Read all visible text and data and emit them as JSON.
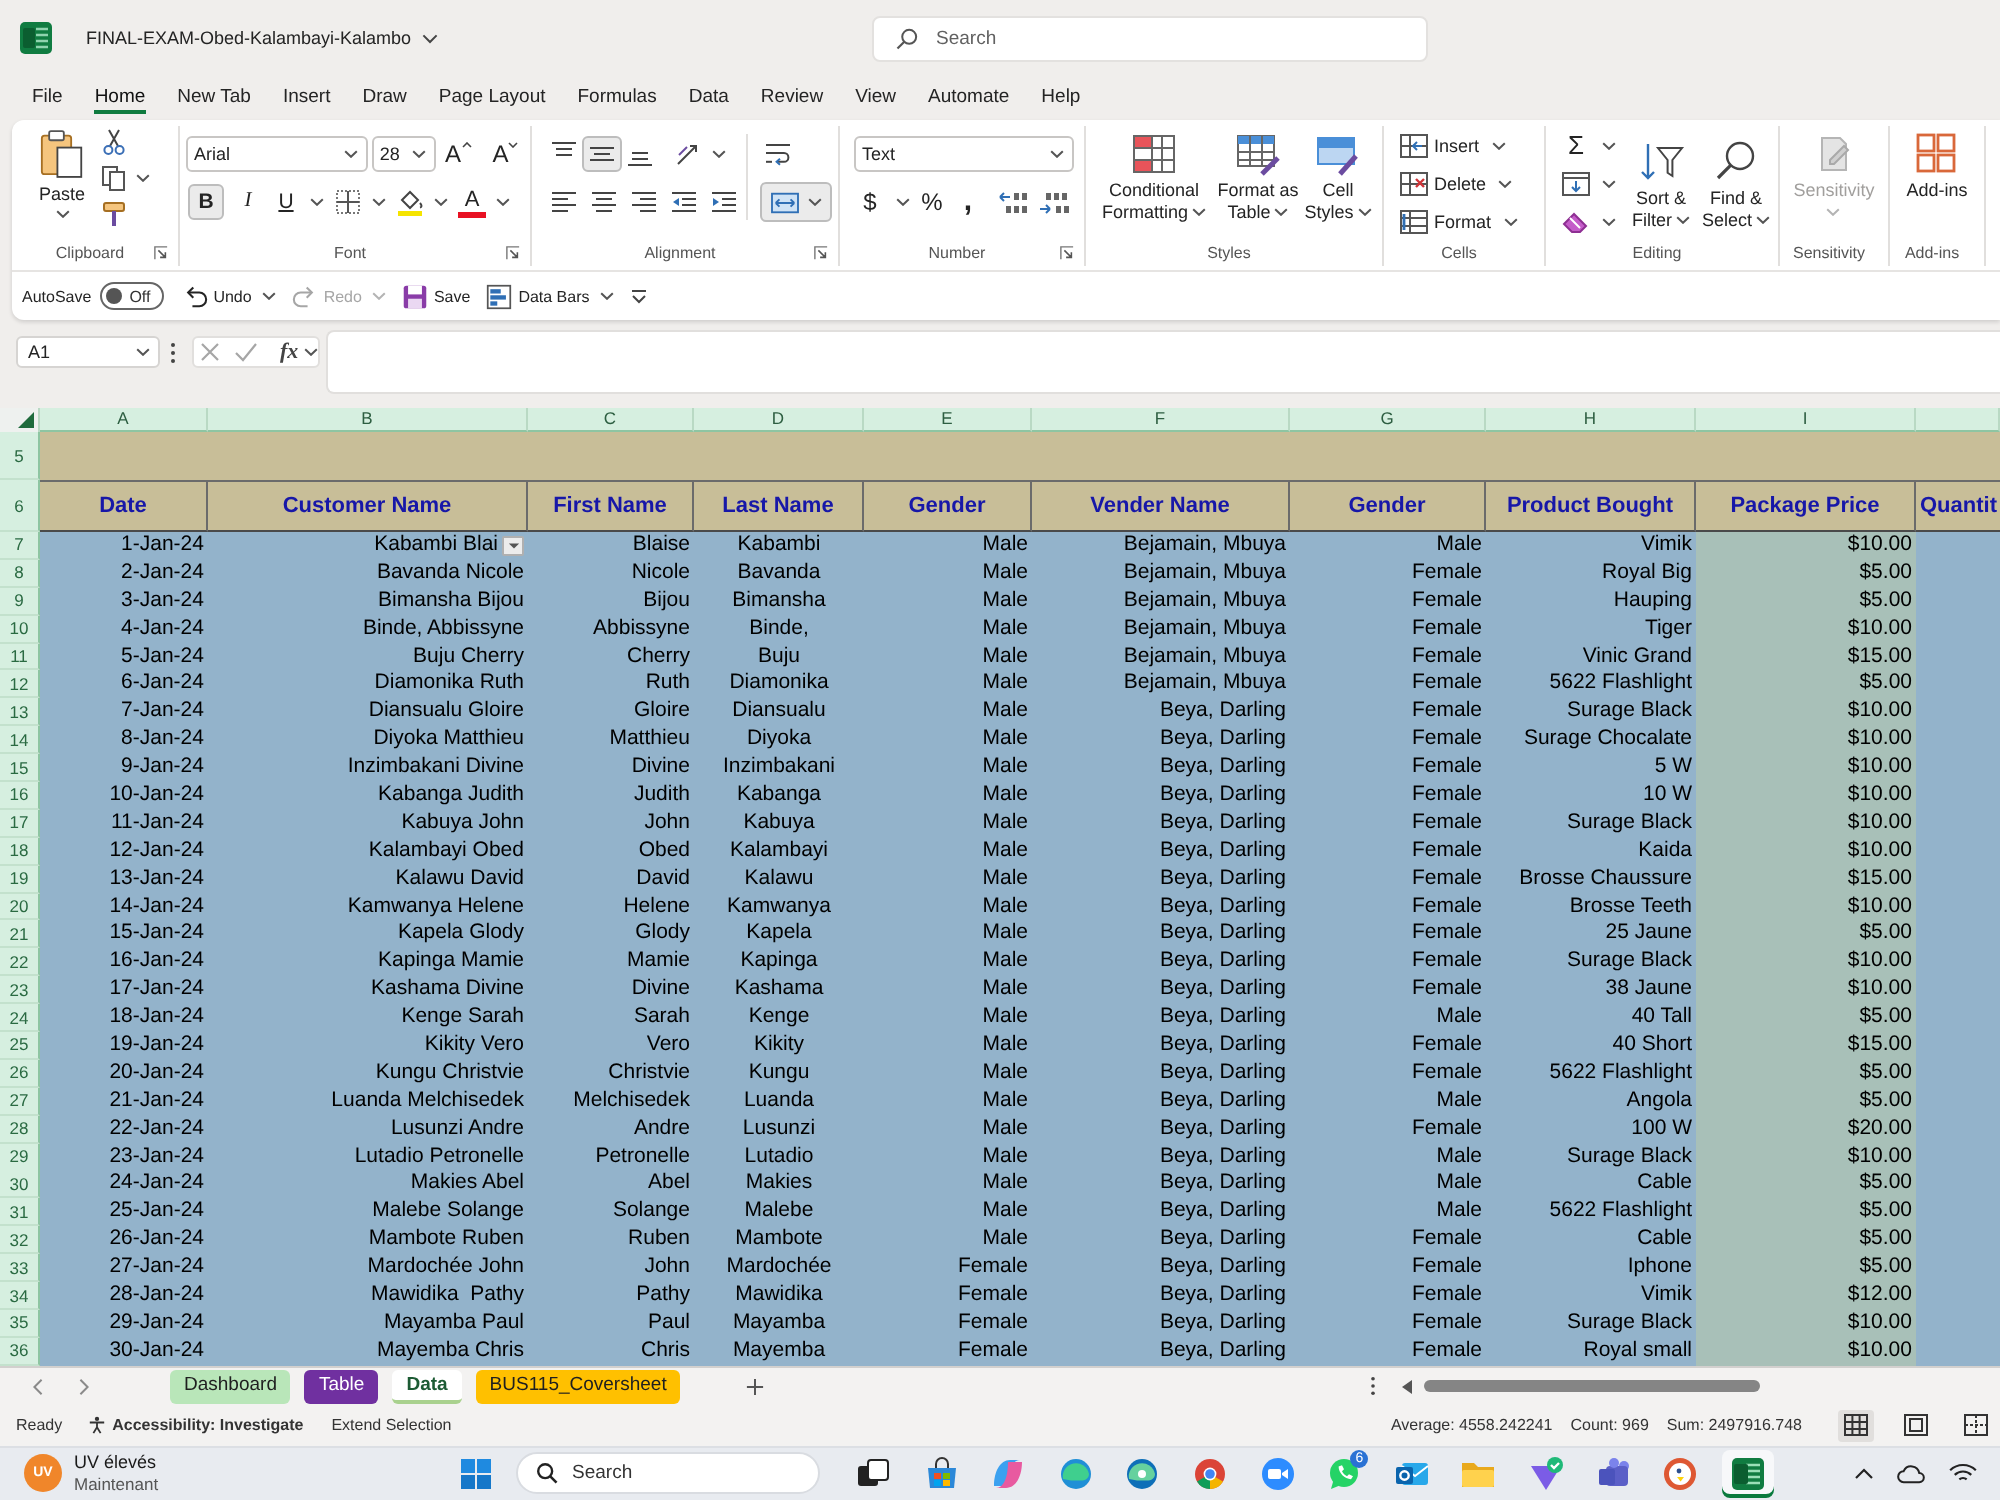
{
  "window": {
    "title": "FINAL-EXAM-Obed-Kalambayi-Kalambo"
  },
  "search": {
    "placeholder": "Search"
  },
  "menu_tabs": [
    {
      "label": "File",
      "selected": false
    },
    {
      "label": "Home",
      "selected": true
    },
    {
      "label": "New Tab",
      "selected": false
    },
    {
      "label": "Insert",
      "selected": false
    },
    {
      "label": "Draw",
      "selected": false
    },
    {
      "label": "Page Layout",
      "selected": false
    },
    {
      "label": "Formulas",
      "selected": false
    },
    {
      "label": "Data",
      "selected": false
    },
    {
      "label": "Review",
      "selected": false
    },
    {
      "label": "View",
      "selected": false
    },
    {
      "label": "Automate",
      "selected": false
    },
    {
      "label": "Help",
      "selected": false
    }
  ],
  "ribbon": {
    "groups": [
      {
        "kind": "clipboard",
        "label": "Clipboard",
        "paste": "Paste"
      },
      {
        "kind": "font",
        "label": "Font",
        "font_name": "Arial",
        "font_size": "28",
        "size_glyphs": [
          "A",
          "A"
        ],
        "styles": [
          {
            "kind": "bold",
            "glyph": "B",
            "selected": true
          },
          {
            "kind": "italic",
            "glyph": "I",
            "selected": false
          },
          {
            "kind": "underline",
            "glyph": "U",
            "selected": false
          }
        ],
        "color_glyph": "A"
      },
      {
        "kind": "alignment",
        "label": "Alignment",
        "vertical": [
          {
            "kind": "top",
            "selected": false
          },
          {
            "kind": "middle",
            "selected": true
          },
          {
            "kind": "bottom",
            "selected": false
          }
        ],
        "merge_selected": true
      },
      {
        "kind": "number",
        "label": "Number",
        "format": "Text",
        "symbols": [
          "$",
          "%",
          ","
        ]
      },
      {
        "kind": "styles",
        "label": "Styles",
        "buttons": [
          {
            "kind": "conditional",
            "lines": [
              "Conditional",
              "Formatting"
            ]
          },
          {
            "kind": "table",
            "lines": [
              "Format as",
              "Table"
            ]
          },
          {
            "kind": "cell",
            "lines": [
              "Cell",
              "Styles"
            ]
          }
        ]
      },
      {
        "kind": "cells",
        "label": "Cells",
        "buttons": [
          {
            "kind": "insert",
            "label": "Insert"
          },
          {
            "kind": "delete",
            "label": "Delete"
          },
          {
            "kind": "format",
            "label": "Format"
          }
        ]
      },
      {
        "kind": "editing",
        "label": "Editing",
        "sum_glyph": "Σ",
        "buttons": [
          {
            "kind": "sort",
            "lines": [
              "Sort &",
              "Filter"
            ]
          },
          {
            "kind": "find",
            "lines": [
              "Find &",
              "Select"
            ]
          }
        ]
      },
      {
        "kind": "sensitivity",
        "label": "Sensitivity",
        "button": "Sensitivity",
        "disabled": true
      },
      {
        "kind": "addins",
        "label": "Add-ins",
        "button": "Add-ins"
      }
    ]
  },
  "quick_access": {
    "autosave": {
      "label": "AutoSave",
      "on": false,
      "state_label": "Off"
    },
    "items": [
      {
        "kind": "undo",
        "label": "Undo",
        "disabled": false
      },
      {
        "kind": "redo",
        "label": "Redo",
        "disabled": true
      },
      {
        "kind": "save",
        "label": "Save",
        "disabled": false
      },
      {
        "kind": "data_bars",
        "label": "Data Bars",
        "disabled": false
      }
    ]
  },
  "formula_bar": {
    "name_box": "A1",
    "function_label": "fx"
  },
  "sheet": {
    "columns": [
      "A",
      "B",
      "C",
      "D",
      "E",
      "F",
      "G",
      "H",
      "I"
    ],
    "title_row": {
      "number": "5"
    },
    "header_row": {
      "number": "6",
      "cells": [
        "Date",
        "Customer Name",
        "First Name",
        "Last Name",
        "Gender",
        "Vender Name",
        "Gender",
        "Product Bought",
        "Package Price",
        "Quantit"
      ]
    },
    "rows": [
      {
        "number": "7",
        "cells": [
          "1-Jan-24",
          {
            "text": "Kabambi Blai",
            "dropdown": true
          },
          "Blaise",
          "Kabambi",
          "Male",
          "Bejamain, Mbuya",
          "Male",
          "Vimik",
          "$10.00"
        ]
      },
      {
        "number": "8",
        "cells": [
          "2-Jan-24",
          "Bavanda Nicole",
          "Nicole",
          "Bavanda",
          "Male",
          "Bejamain, Mbuya",
          "Female",
          "Royal Big",
          "$5.00"
        ]
      },
      {
        "number": "9",
        "cells": [
          "3-Jan-24",
          "Bimansha Bijou",
          "Bijou",
          "Bimansha",
          "Male",
          "Bejamain, Mbuya",
          "Female",
          "Hauping",
          "$5.00"
        ]
      },
      {
        "number": "10",
        "cells": [
          "4-Jan-24",
          "Binde, Abbissyne",
          "Abbissyne",
          "Binde,",
          "Male",
          "Bejamain, Mbuya",
          "Female",
          "Tiger",
          "$10.00"
        ]
      },
      {
        "number": "11",
        "cells": [
          "5-Jan-24",
          "Buju Cherry",
          "Cherry",
          "Buju",
          "Male",
          "Bejamain, Mbuya",
          "Female",
          "Vinic Grand",
          "$15.00"
        ]
      },
      {
        "number": "12",
        "cells": [
          "6-Jan-24",
          "Diamonika Ruth",
          "Ruth",
          "Diamonika",
          "Male",
          "Bejamain, Mbuya",
          "Female",
          "5622 Flashlight",
          "$5.00"
        ]
      },
      {
        "number": "13",
        "cells": [
          "7-Jan-24",
          "Diansualu Gloire",
          "Gloire",
          "Diansualu",
          "Male",
          "Beya, Darling",
          "Female",
          "Surage Black",
          "$10.00"
        ]
      },
      {
        "number": "14",
        "cells": [
          "8-Jan-24",
          "Diyoka Matthieu",
          "Matthieu",
          "Diyoka",
          "Male",
          "Beya, Darling",
          "Female",
          "Surage Chocalate",
          "$10.00"
        ]
      },
      {
        "number": "15",
        "cells": [
          "9-Jan-24",
          "Inzimbakani Divine",
          "Divine",
          "Inzimbakani",
          "Male",
          "Beya, Darling",
          "Female",
          "5 W",
          "$10.00"
        ]
      },
      {
        "number": "16",
        "cells": [
          "10-Jan-24",
          "Kabanga Judith",
          "Judith",
          "Kabanga",
          "Male",
          "Beya, Darling",
          "Female",
          "10 W",
          "$10.00"
        ]
      },
      {
        "number": "17",
        "cells": [
          "11-Jan-24",
          "Kabuya John",
          "John",
          "Kabuya",
          "Male",
          "Beya, Darling",
          "Female",
          "Surage Black",
          "$10.00"
        ]
      },
      {
        "number": "18",
        "cells": [
          "12-Jan-24",
          "Kalambayi Obed",
          "Obed",
          "Kalambayi",
          "Male",
          "Beya, Darling",
          "Female",
          "Kaida",
          "$10.00"
        ]
      },
      {
        "number": "19",
        "cells": [
          "13-Jan-24",
          "Kalawu David",
          "David",
          "Kalawu",
          "Male",
          "Beya, Darling",
          "Female",
          "Brosse Chaussure",
          "$15.00"
        ]
      },
      {
        "number": "20",
        "cells": [
          "14-Jan-24",
          "Kamwanya Helene",
          "Helene",
          "Kamwanya",
          "Male",
          "Beya, Darling",
          "Female",
          "Brosse Teeth",
          "$10.00"
        ]
      },
      {
        "number": "21",
        "cells": [
          "15-Jan-24",
          "Kapela Glody",
          "Glody",
          "Kapela",
          "Male",
          "Beya, Darling",
          "Female",
          "25 Jaune",
          "$5.00"
        ]
      },
      {
        "number": "22",
        "cells": [
          "16-Jan-24",
          "Kapinga Mamie",
          "Mamie",
          "Kapinga",
          "Male",
          "Beya, Darling",
          "Female",
          "Surage Black",
          "$10.00"
        ]
      },
      {
        "number": "23",
        "cells": [
          "17-Jan-24",
          "Kashama Divine",
          "Divine",
          "Kashama",
          "Male",
          "Beya, Darling",
          "Female",
          "38 Jaune",
          "$10.00"
        ]
      },
      {
        "number": "24",
        "cells": [
          "18-Jan-24",
          "Kenge Sarah",
          "Sarah",
          "Kenge",
          "Male",
          "Beya, Darling",
          "Male",
          "40 Tall",
          "$5.00"
        ]
      },
      {
        "number": "25",
        "cells": [
          "19-Jan-24",
          "Kikity Vero",
          "Vero",
          "Kikity",
          "Male",
          "Beya, Darling",
          "Female",
          "40 Short",
          "$15.00"
        ]
      },
      {
        "number": "26",
        "cells": [
          "20-Jan-24",
          "Kungu Christvie",
          "Christvie",
          "Kungu",
          "Male",
          "Beya, Darling",
          "Female",
          "5622 Flashlight",
          "$5.00"
        ]
      },
      {
        "number": "27",
        "cells": [
          "21-Jan-24",
          "Luanda Melchisedek",
          "Melchisedek",
          "Luanda",
          "Male",
          "Beya, Darling",
          "Male",
          "Angola",
          "$5.00"
        ]
      },
      {
        "number": "28",
        "cells": [
          "22-Jan-24",
          "Lusunzi Andre",
          "Andre",
          "Lusunzi",
          "Male",
          "Beya, Darling",
          "Female",
          "100 W",
          "$20.00"
        ]
      },
      {
        "number": "29",
        "cells": [
          "23-Jan-24",
          "Lutadio Petronelle",
          "Petronelle",
          "Lutadio",
          "Male",
          "Beya, Darling",
          "Male",
          "Surage Black",
          "$10.00"
        ]
      },
      {
        "number": "30",
        "cells": [
          "24-Jan-24",
          "Makies Abel",
          "Abel",
          "Makies",
          "Male",
          "Beya, Darling",
          "Male",
          "Cable",
          "$5.00"
        ]
      },
      {
        "number": "31",
        "cells": [
          "25-Jan-24",
          "Malebe Solange",
          "Solange",
          "Malebe",
          "Male",
          "Beya, Darling",
          "Male",
          "5622 Flashlight",
          "$5.00"
        ]
      },
      {
        "number": "32",
        "cells": [
          "26-Jan-24",
          "Mambote Ruben",
          "Ruben",
          "Mambote",
          "Male",
          "Beya, Darling",
          "Female",
          "Cable",
          "$5.00"
        ]
      },
      {
        "number": "33",
        "cells": [
          "27-Jan-24",
          "Mardochée John",
          "John",
          "Mardochée",
          "Female",
          "Beya, Darling",
          "Female",
          "Iphone",
          "$5.00"
        ]
      },
      {
        "number": "34",
        "cells": [
          "28-Jan-24",
          "Mawidika  Pathy",
          "Pathy",
          "Mawidika",
          "Female",
          "Beya, Darling",
          "Female",
          "Vimik",
          "$12.00"
        ]
      },
      {
        "number": "35",
        "cells": [
          "29-Jan-24",
          "Mayamba Paul",
          "Paul",
          "Mayamba",
          "Female",
          "Beya, Darling",
          "Female",
          "Surage Black",
          "$10.00"
        ]
      },
      {
        "number": "36",
        "cells": [
          "30-Jan-24",
          "Mayemba Chris",
          "Chris",
          "Mayemba",
          "Female",
          "Beya, Darling",
          "Female",
          "Royal small",
          "$10.00"
        ]
      }
    ]
  },
  "sheet_tabs": [
    {
      "label": "Dashboard",
      "color": "#b9e6b9",
      "selected": false
    },
    {
      "label": "Table",
      "color": "#7030a0",
      "selected": false
    },
    {
      "label": "Data",
      "color": "#a9d18e",
      "selected": true
    },
    {
      "label": "BUS115_Coversheet",
      "color": "#ffc000",
      "selected": false
    }
  ],
  "status_bar": {
    "mode": "Ready",
    "accessibility": "Accessibility: Investigate",
    "selection_mode": "Extend Selection",
    "stats": [
      "Average: 4558.242241",
      "Count: 969",
      "Sum: 2497916.748"
    ],
    "views": [
      {
        "kind": "normal",
        "selected": true
      },
      {
        "kind": "page_layout",
        "selected": false
      },
      {
        "kind": "page_break",
        "selected": false
      }
    ]
  },
  "taskbar": {
    "notification": {
      "badge": "UV",
      "title": "UV élevés",
      "subtitle": "Maintenant"
    },
    "search": {
      "placeholder": "Search"
    },
    "apps": [
      {
        "kind": "task_view",
        "active": false
      },
      {
        "kind": "store",
        "active": false
      },
      {
        "kind": "assistant",
        "active": false
      },
      {
        "kind": "browser",
        "active": false
      },
      {
        "kind": "browser_beta",
        "active": false
      },
      {
        "kind": "browser_round",
        "active": false
      },
      {
        "kind": "video",
        "active": false
      },
      {
        "kind": "chat",
        "active": false,
        "badge": "6"
      },
      {
        "kind": "mail",
        "active": false
      },
      {
        "kind": "files",
        "active": false
      },
      {
        "kind": "vpn",
        "active": false
      },
      {
        "kind": "teams",
        "active": false
      },
      {
        "kind": "duck",
        "active": false
      },
      {
        "kind": "spreadsheet",
        "active": true
      }
    ]
  }
}
